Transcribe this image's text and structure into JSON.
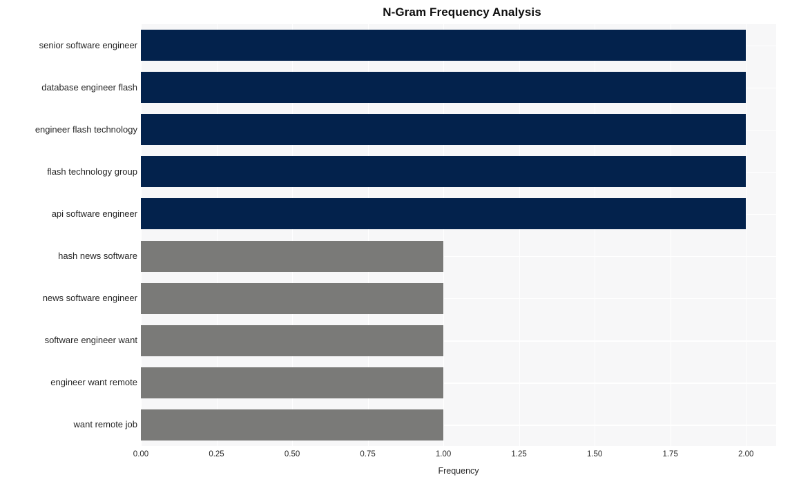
{
  "chart_data": {
    "type": "bar",
    "orientation": "horizontal",
    "title": "N-Gram Frequency Analysis",
    "xlabel": "Frequency",
    "ylabel": "",
    "categories": [
      "senior software engineer",
      "database engineer flash",
      "engineer flash technology",
      "flash technology group",
      "api software engineer",
      "hash news software",
      "news software engineer",
      "software engineer want",
      "engineer want remote",
      "want remote job"
    ],
    "values": [
      2,
      2,
      2,
      2,
      2,
      1,
      1,
      1,
      1,
      1
    ],
    "bar_colors": [
      "#03224c",
      "#03224c",
      "#03224c",
      "#03224c",
      "#03224c",
      "#7a7a78",
      "#7a7a78",
      "#7a7a78",
      "#7a7a78",
      "#7a7a78"
    ],
    "xlim": [
      0,
      2.1
    ],
    "xticks": [
      0,
      0.25,
      0.5,
      0.75,
      1,
      1.25,
      1.5,
      1.75,
      2
    ],
    "xtick_labels": [
      "0.00",
      "0.25",
      "0.50",
      "0.75",
      "1.00",
      "1.25",
      "1.50",
      "1.75",
      "2.00"
    ],
    "grid": true,
    "grid_color": "#ffffff",
    "plot_background": "#f7f7f8",
    "figure_background": "#ffffff",
    "legend": null,
    "legend_position": "none"
  }
}
